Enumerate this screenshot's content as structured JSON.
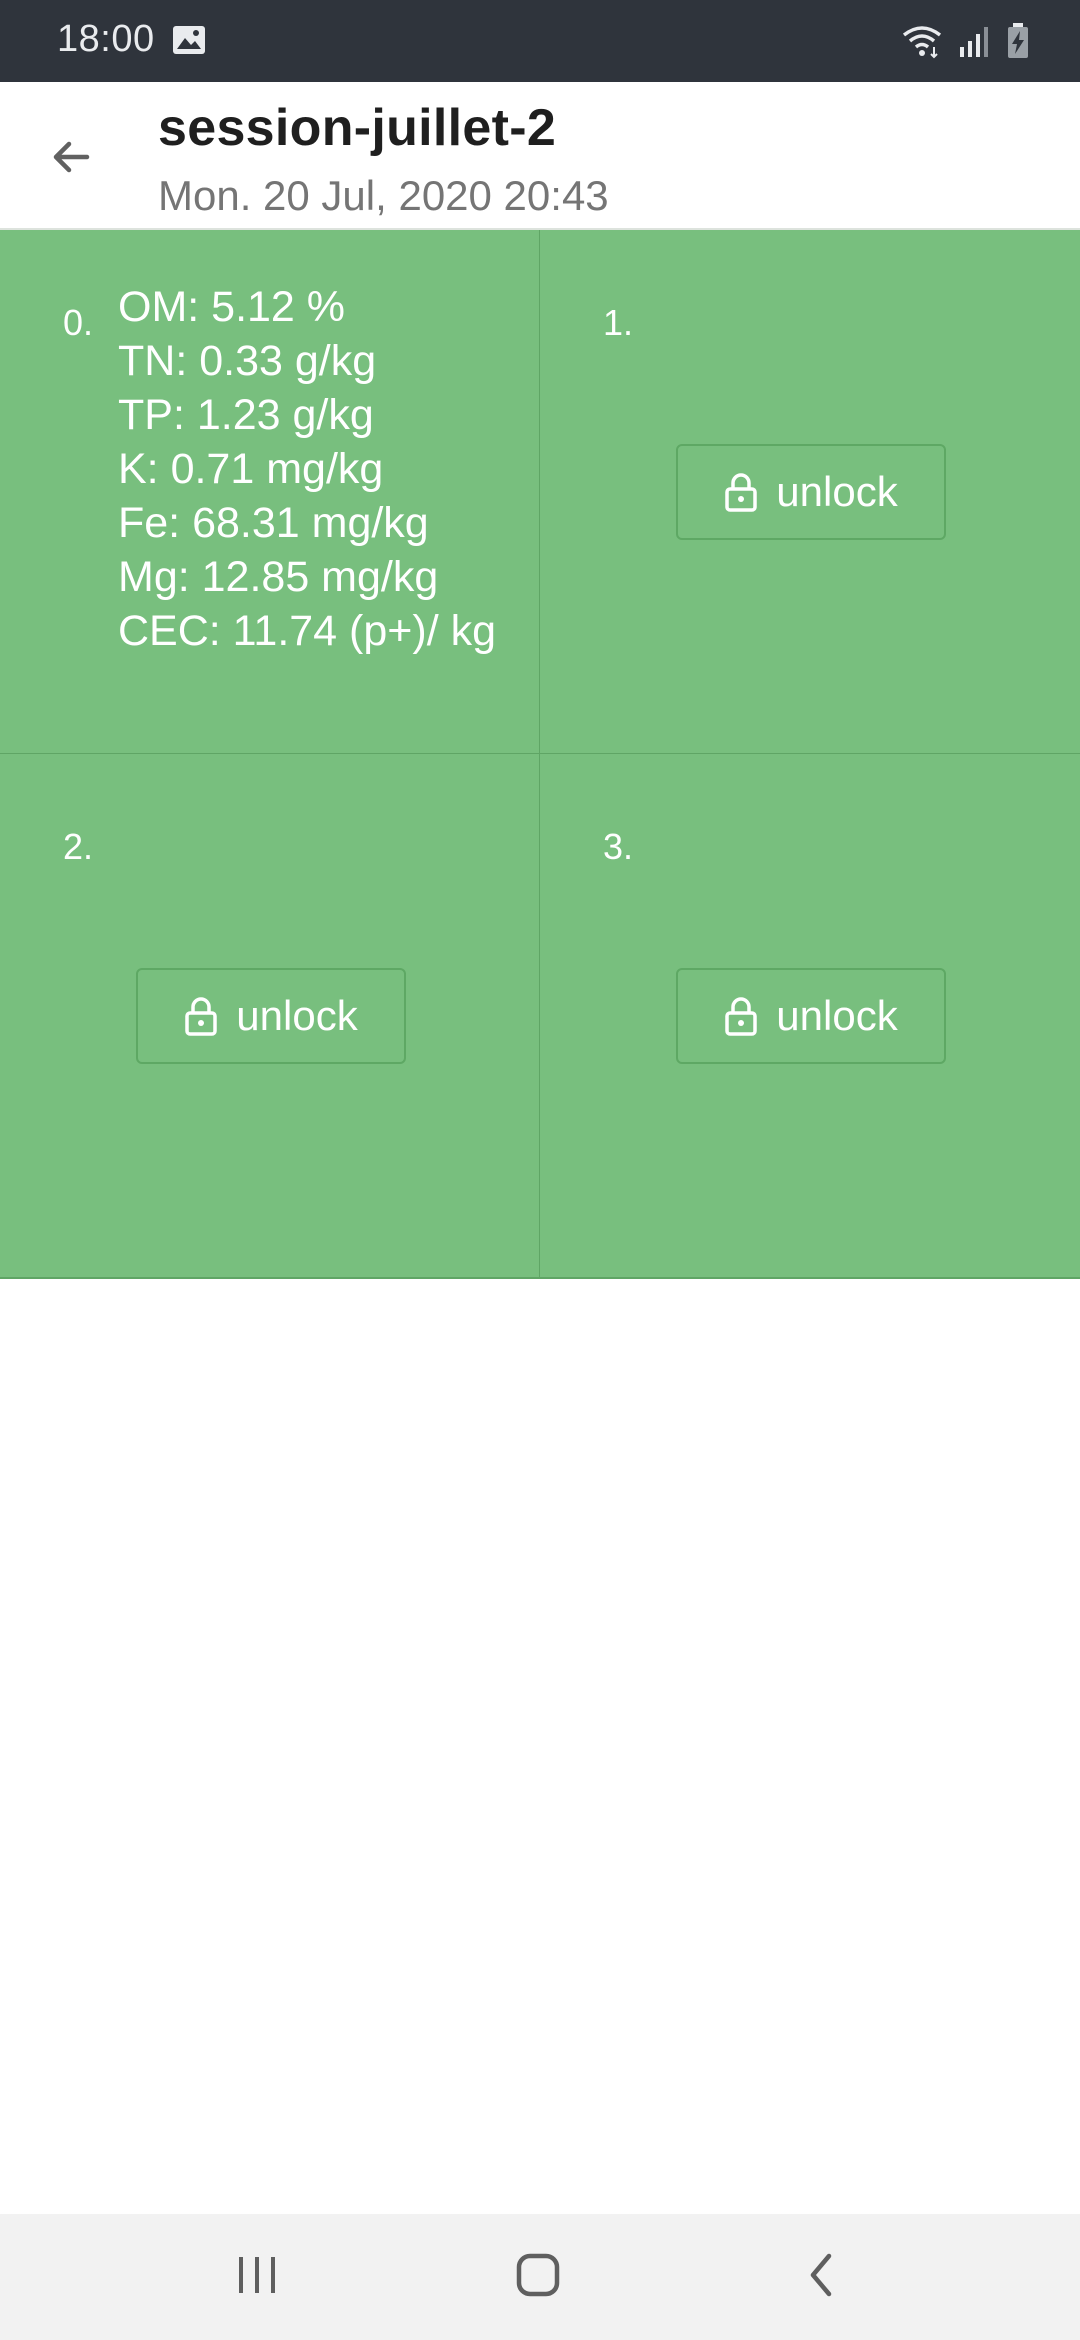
{
  "status_bar": {
    "time": "18:00",
    "icons": [
      "gallery-icon",
      "wifi-icon",
      "signal-icon",
      "battery-charging-icon"
    ]
  },
  "header": {
    "back_icon": "arrow-left-icon",
    "title": "session-juillet-2",
    "subtitle": "Mon. 20 Jul, 2020 20:43"
  },
  "samples": [
    {
      "index": "0.",
      "results": [
        "OM: 5.12 %",
        "TN: 0.33 g/kg",
        "TP: 1.23 g/kg",
        "K: 0.71 mg/kg",
        "Fe: 68.31 mg/kg",
        "Mg: 12.85 mg/kg",
        "CEC: 11.74 (p+)/ kg"
      ]
    },
    {
      "index": "1.",
      "unlock_label": "unlock"
    },
    {
      "index": "2.",
      "unlock_label": "unlock"
    },
    {
      "index": "3.",
      "unlock_label": "unlock"
    }
  ],
  "colors": {
    "cell_background": "#78bf7e",
    "status_bar": "#2f343c",
    "nav_bar": "#f2f2f2"
  },
  "nav_bar": {
    "icons": [
      "recents-icon",
      "home-icon",
      "back-icon"
    ]
  }
}
